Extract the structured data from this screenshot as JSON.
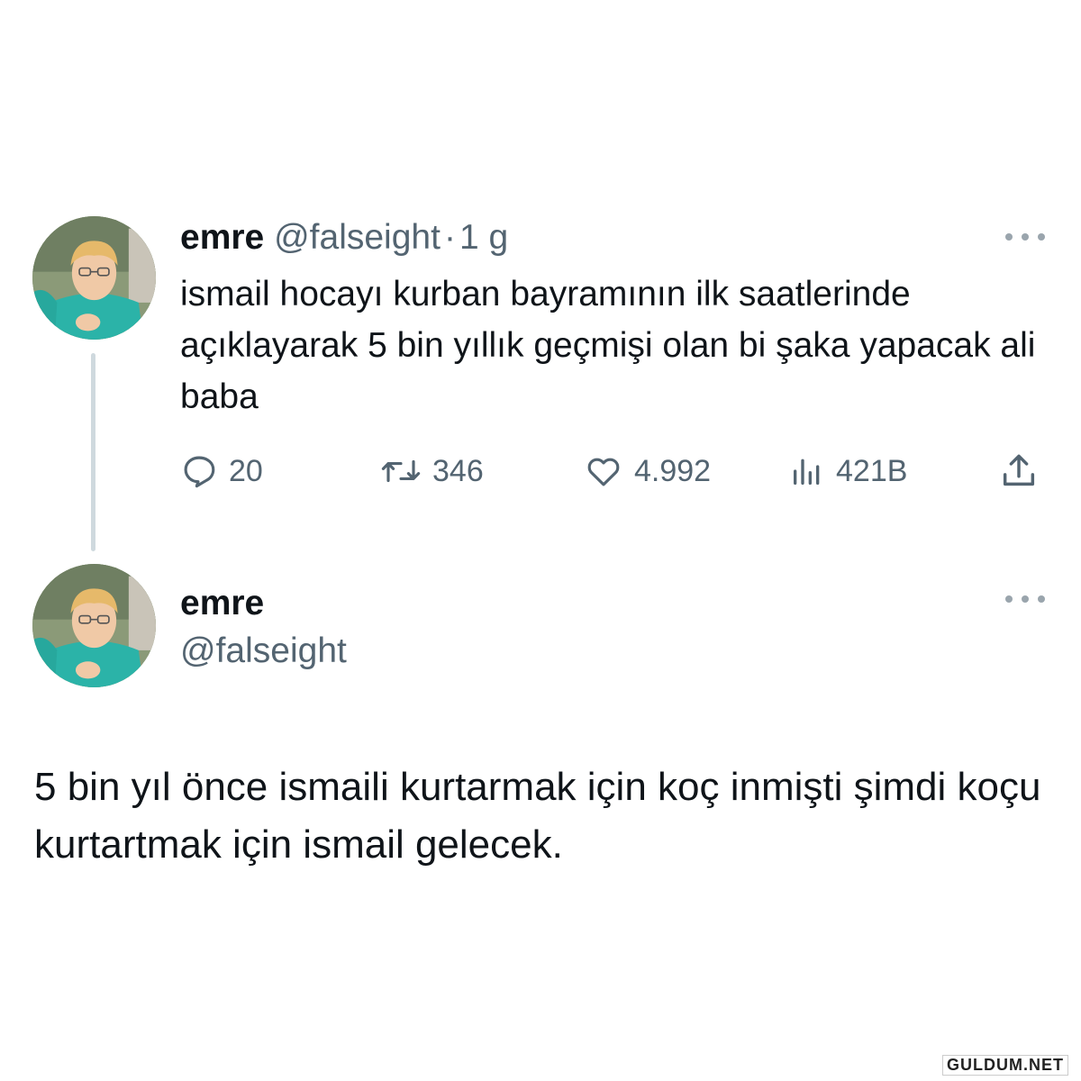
{
  "tweet1": {
    "name": "emre",
    "handle": "@falseight",
    "separator": "·",
    "time": "1 g",
    "text": "ismail hocayı kurban bayramının ilk saatlerinde açıklayarak 5 bin yıllık geçmişi olan bi şaka yapacak ali baba",
    "actions": {
      "reply_count": "20",
      "retweet_count": "346",
      "like_count": "4.992",
      "views_count": "421B"
    }
  },
  "tweet2": {
    "name": "emre",
    "handle": "@falseight",
    "text": "5 bin yıl önce ismaili kurtarmak için koç inmişti şimdi koçu kurtartmak için ismail gelecek."
  },
  "watermark": "GULDUM.NET",
  "colors": {
    "primary_text": "#0f1419",
    "secondary_text": "#536471",
    "thread_line": "#cfd9de",
    "background": "#ffffff"
  },
  "icons": [
    "reply-icon",
    "retweet-icon",
    "like-icon",
    "views-icon",
    "share-icon",
    "more-options-icon"
  ]
}
